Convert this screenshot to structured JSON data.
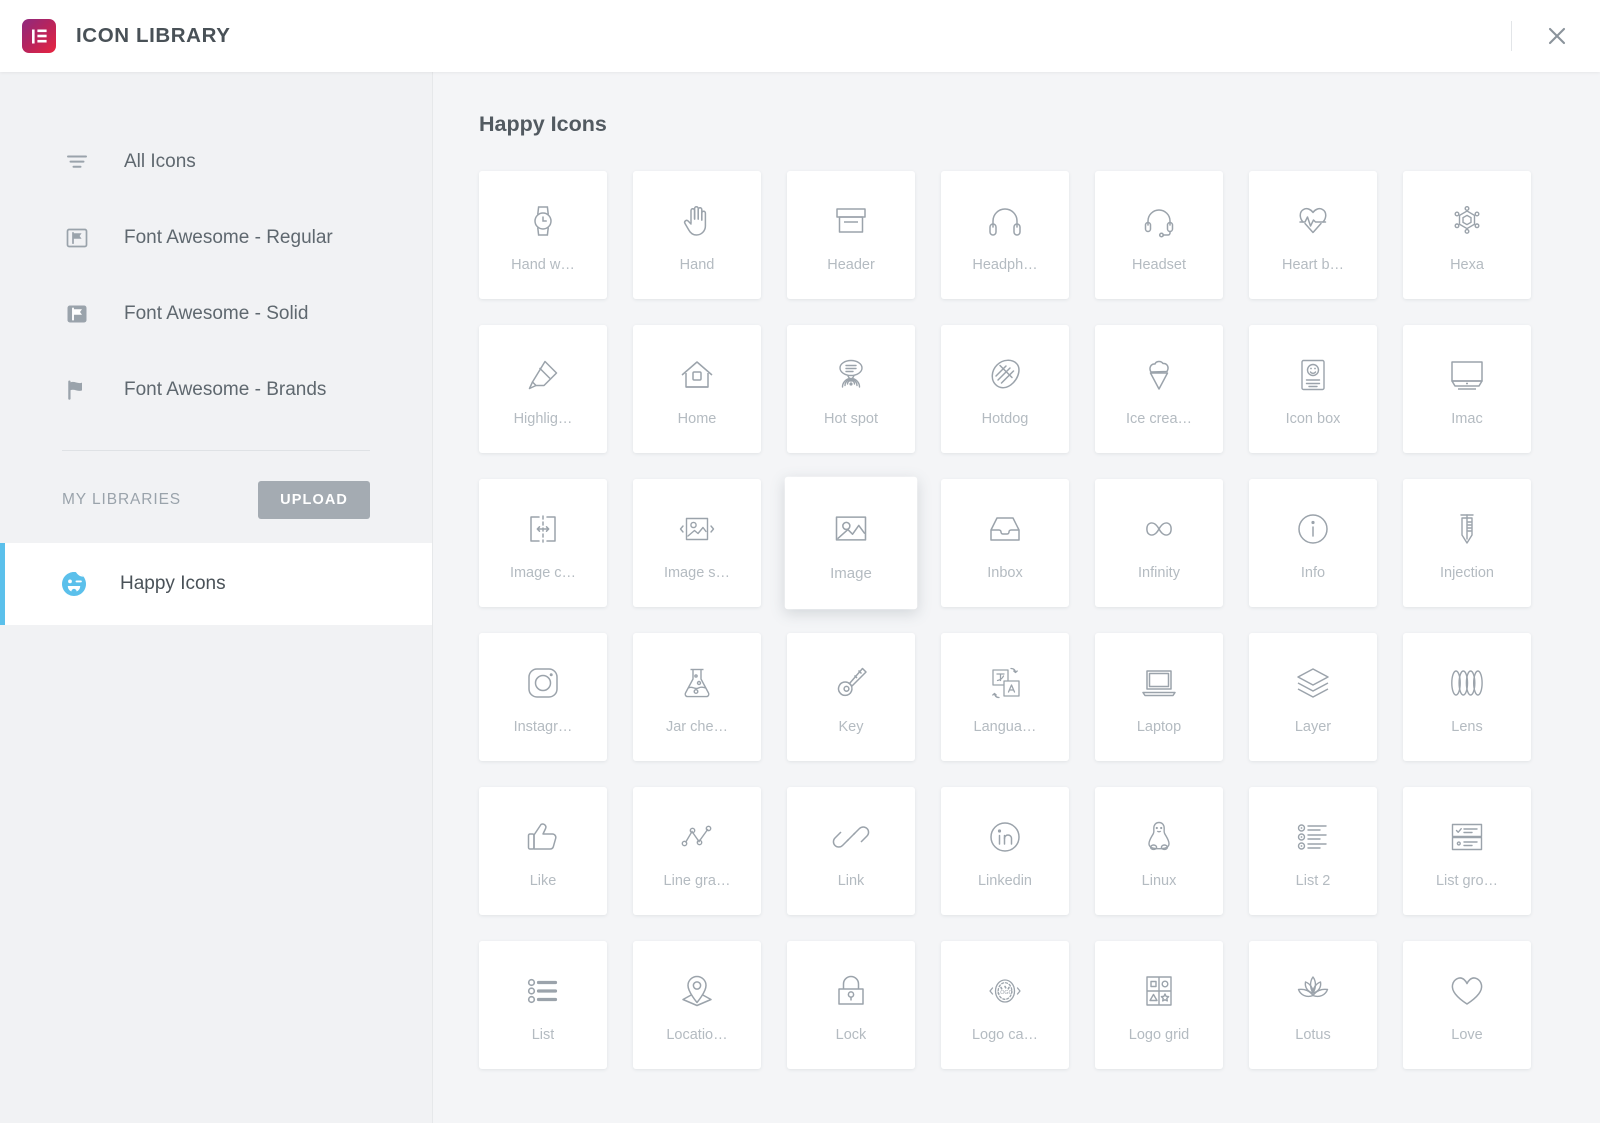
{
  "header": {
    "title": "ICON LIBRARY",
    "logo_icon": "elementor-logo-icon",
    "logo_gradient_from": "#8e2a7f",
    "logo_gradient_to": "#e8243f",
    "close_icon": "close-icon"
  },
  "sidebar": {
    "nav": [
      {
        "label": "All Icons",
        "icon": "filter-icon"
      },
      {
        "label": "Font Awesome - Regular",
        "icon": "flag-regular-icon"
      },
      {
        "label": "Font Awesome - Solid",
        "icon": "flag-solid-icon"
      },
      {
        "label": "Font Awesome - Brands",
        "icon": "flag-brands-icon"
      }
    ],
    "my_libraries": {
      "label": "MY LIBRARIES",
      "upload_label": "UPLOAD",
      "items": [
        {
          "label": "Happy Icons",
          "icon": "happy-face-icon",
          "active": true,
          "accent_color": "#5bc0eb"
        }
      ]
    }
  },
  "content": {
    "title": "Happy Icons",
    "icons": [
      {
        "label": "Hand w…",
        "icon": "hand-watch-icon"
      },
      {
        "label": "Hand",
        "icon": "hand-icon"
      },
      {
        "label": "Header",
        "icon": "header-icon"
      },
      {
        "label": "Headph…",
        "icon": "headphones-icon"
      },
      {
        "label": "Headset",
        "icon": "headset-icon"
      },
      {
        "label": "Heart b…",
        "icon": "heartbeat-icon"
      },
      {
        "label": "Hexa",
        "icon": "hexa-icon"
      },
      {
        "label": "Highlig…",
        "icon": "highlighter-icon"
      },
      {
        "label": "Home",
        "icon": "home-icon"
      },
      {
        "label": "Hot spot",
        "icon": "hot-spot-icon"
      },
      {
        "label": "Hotdog",
        "icon": "hotdog-icon"
      },
      {
        "label": "Ice crea…",
        "icon": "ice-cream-icon"
      },
      {
        "label": "Icon box",
        "icon": "icon-box-icon"
      },
      {
        "label": "Imac",
        "icon": "imac-icon"
      },
      {
        "label": "Image c…",
        "icon": "image-crop-icon"
      },
      {
        "label": "Image s…",
        "icon": "image-slider-icon"
      },
      {
        "label": "Image",
        "icon": "image-icon",
        "hover": true
      },
      {
        "label": "Inbox",
        "icon": "inbox-icon"
      },
      {
        "label": "Infinity",
        "icon": "infinity-icon"
      },
      {
        "label": "Info",
        "icon": "info-icon"
      },
      {
        "label": "Injection",
        "icon": "injection-icon"
      },
      {
        "label": "Instagr…",
        "icon": "instagram-icon"
      },
      {
        "label": "Jar che…",
        "icon": "jar-chemistry-icon"
      },
      {
        "label": "Key",
        "icon": "key-icon"
      },
      {
        "label": "Langua…",
        "icon": "language-icon"
      },
      {
        "label": "Laptop",
        "icon": "laptop-icon"
      },
      {
        "label": "Layer",
        "icon": "layer-icon"
      },
      {
        "label": "Lens",
        "icon": "lens-icon"
      },
      {
        "label": "Like",
        "icon": "like-icon"
      },
      {
        "label": "Line gra…",
        "icon": "line-graph-icon"
      },
      {
        "label": "Link",
        "icon": "link-icon"
      },
      {
        "label": "Linkedin",
        "icon": "linkedin-icon"
      },
      {
        "label": "Linux",
        "icon": "linux-icon"
      },
      {
        "label": "List 2",
        "icon": "list-2-icon"
      },
      {
        "label": "List gro…",
        "icon": "list-group-icon"
      },
      {
        "label": "List",
        "icon": "list-icon"
      },
      {
        "label": "Locatio…",
        "icon": "location-icon"
      },
      {
        "label": "Lock",
        "icon": "lock-icon"
      },
      {
        "label": "Logo ca…",
        "icon": "logo-carousel-icon"
      },
      {
        "label": "Logo grid",
        "icon": "logo-grid-icon"
      },
      {
        "label": "Lotus",
        "icon": "lotus-icon"
      },
      {
        "label": "Love",
        "icon": "love-icon"
      }
    ]
  }
}
